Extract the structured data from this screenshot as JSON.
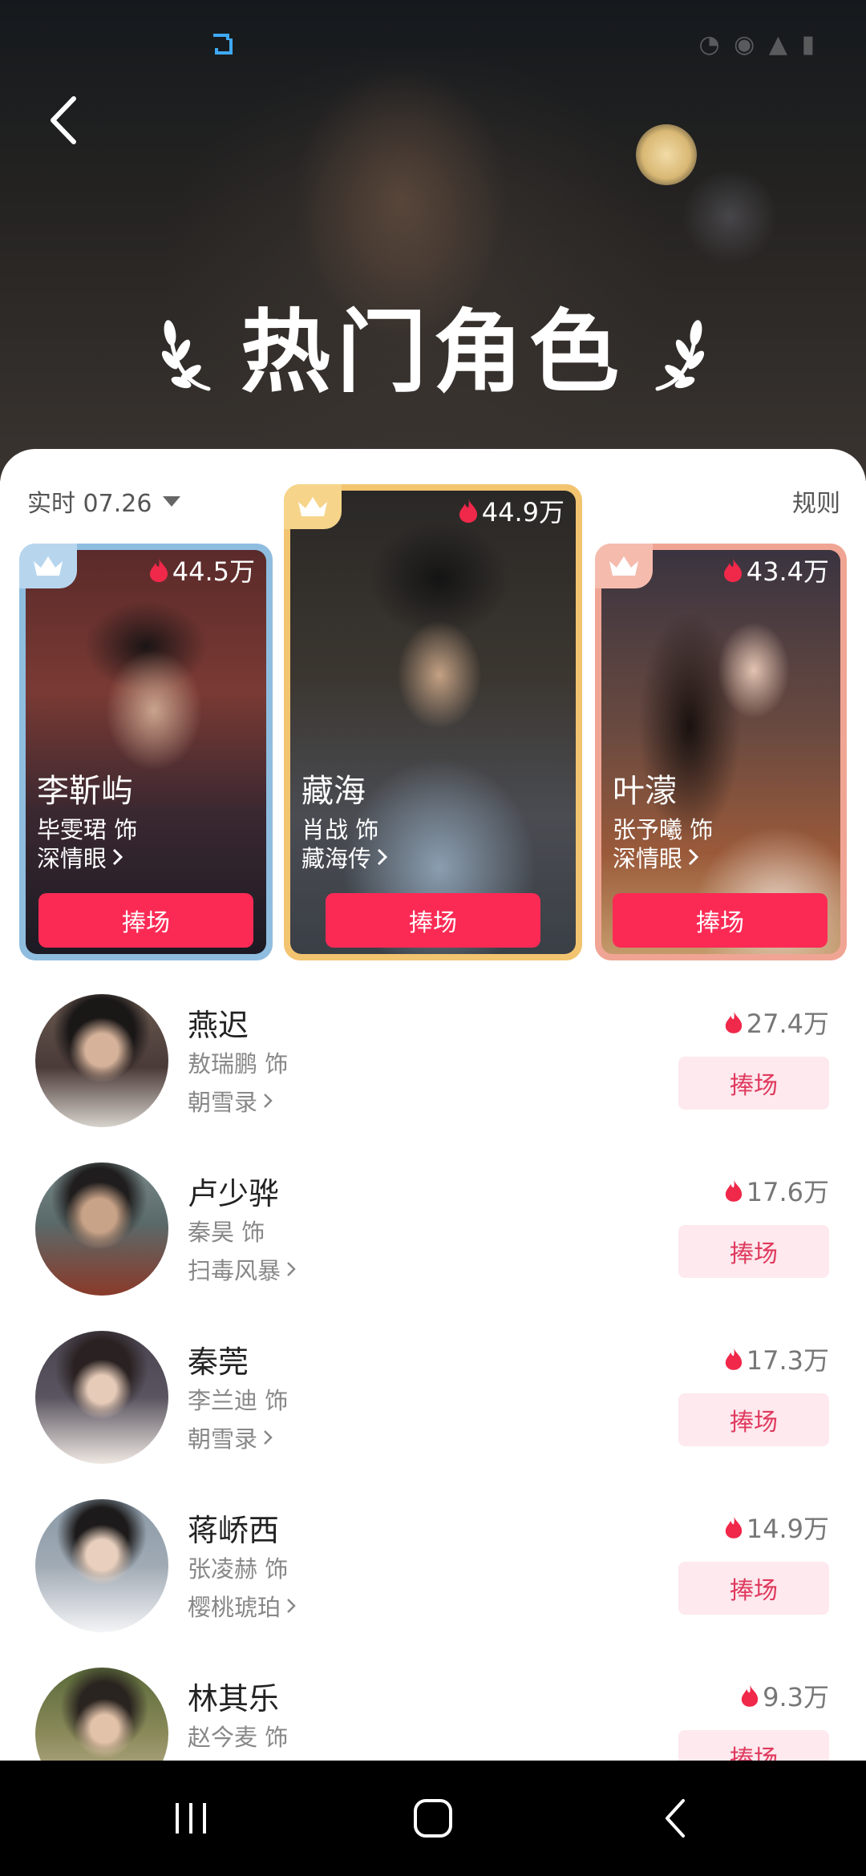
{
  "header": {
    "title": "热门角色"
  },
  "controls": {
    "date_label": "实时 07.26",
    "rules_label": "规则"
  },
  "top3": [
    {
      "name": "李靳屿",
      "actor": "毕雯珺 饰",
      "show": "深情眼",
      "heat": "44.5万",
      "button": "捧场",
      "frame_color": "#8fbde0"
    },
    {
      "name": "藏海",
      "actor": "肖战 饰",
      "show": "藏海传",
      "heat": "44.9万",
      "button": "捧场",
      "frame_color": "#f2c470"
    },
    {
      "name": "叶濛",
      "actor": "张予曦 饰",
      "show": "深情眼",
      "heat": "43.4万",
      "button": "捧场",
      "frame_color": "#f0a594"
    }
  ],
  "list": [
    {
      "name": "燕迟",
      "actor": "敖瑞鹏 饰",
      "show": "朝雪录",
      "heat": "27.4万",
      "button": "捧场"
    },
    {
      "name": "卢少骅",
      "actor": "秦昊 饰",
      "show": "扫毒风暴",
      "heat": "17.6万",
      "button": "捧场"
    },
    {
      "name": "秦莞",
      "actor": "李兰迪 饰",
      "show": "朝雪录",
      "heat": "17.3万",
      "button": "捧场"
    },
    {
      "name": "蒋峤西",
      "actor": "张凌赫 饰",
      "show": "樱桃琥珀",
      "heat": "14.9万",
      "button": "捧场"
    },
    {
      "name": "林其乐",
      "actor": "赵今麦 饰",
      "show": "",
      "heat": "9.3万",
      "button": "捧场"
    }
  ],
  "icons": {
    "back": "back-arrow-icon",
    "heat": "flame-icon",
    "crown": "crown-icon",
    "chevron": "chevron-right-icon"
  },
  "colors": {
    "accent": "#fb2a55",
    "accent_soft": "#fde9ee",
    "flame": "#f0284a"
  }
}
